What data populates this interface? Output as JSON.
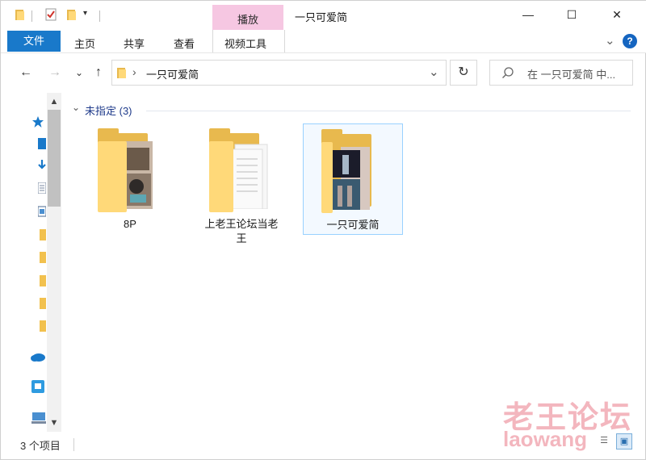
{
  "window": {
    "title": "一只可爱简",
    "context_tab_group": "播放",
    "controls": {
      "minimize": "—",
      "maximize": "☐",
      "close": "✕"
    }
  },
  "ribbon": {
    "file_tab": "文件",
    "tabs": [
      "主页",
      "共享",
      "查看"
    ],
    "context_tab": "视频工具",
    "help_glyph": "?",
    "expand_glyph": "⌄"
  },
  "address_bar": {
    "back_glyph": "←",
    "forward_glyph": "→",
    "recent_glyph": "⌄",
    "up_glyph": "↑",
    "separator_glyph": "›",
    "path": "一只可爱简",
    "dropdown_glyph": "⌄",
    "refresh_glyph": "↻"
  },
  "search": {
    "placeholder": "在 一只可爱简 中..."
  },
  "group": {
    "label": "未指定 (3)",
    "collapse_glyph": "⌄"
  },
  "items": [
    {
      "name": "8P",
      "selected": false
    },
    {
      "name": "上老王论坛当老王",
      "name_line1": "上老王论坛当老",
      "name_line2": "王",
      "selected": false
    },
    {
      "name": "一只可爱简",
      "selected": true
    }
  ],
  "scrollbar": {
    "up_glyph": "▲",
    "down_glyph": "▼"
  },
  "status": {
    "item_count": "3 个项目"
  },
  "watermark": {
    "line1": "老王论坛",
    "line2": "laowang"
  },
  "colors": {
    "accent": "#1979ca",
    "context_tab": "#f6c7e2",
    "folder_back": "#e8b94e",
    "folder_front": "#ffd979",
    "selection_border": "#99d1ff",
    "watermark": "#f3b6be"
  },
  "icons": [
    "folder-icon",
    "checkbox-icon",
    "star-icon",
    "download-icon",
    "onedrive-icon",
    "network-icon",
    "pc-icon",
    "search-icon",
    "help-icon"
  ]
}
